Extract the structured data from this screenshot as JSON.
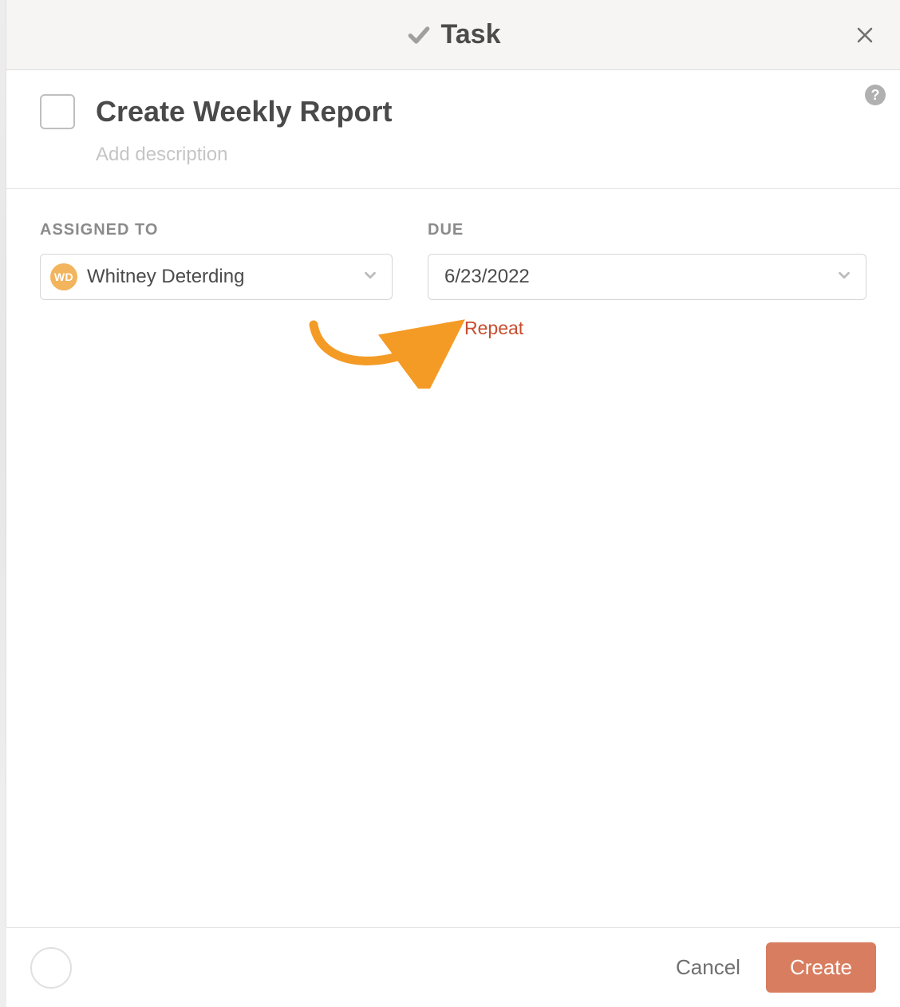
{
  "header": {
    "title": "Task"
  },
  "task": {
    "title": "Create Weekly Report",
    "description_placeholder": "Add description"
  },
  "fields": {
    "assigned": {
      "label": "ASSIGNED TO",
      "person": {
        "initials": "WD",
        "name": "Whitney Deterding"
      }
    },
    "due": {
      "label": "DUE",
      "date": "6/23/2022",
      "repeat_label": "Repeat"
    }
  },
  "help": {
    "glyph": "?"
  },
  "footer": {
    "cancel": "Cancel",
    "create": "Create"
  },
  "colors": {
    "accent": "#c84d2f",
    "avatar": "#f2b45c",
    "create_btn": "#d87d5f",
    "arrow": "#F49B25"
  }
}
